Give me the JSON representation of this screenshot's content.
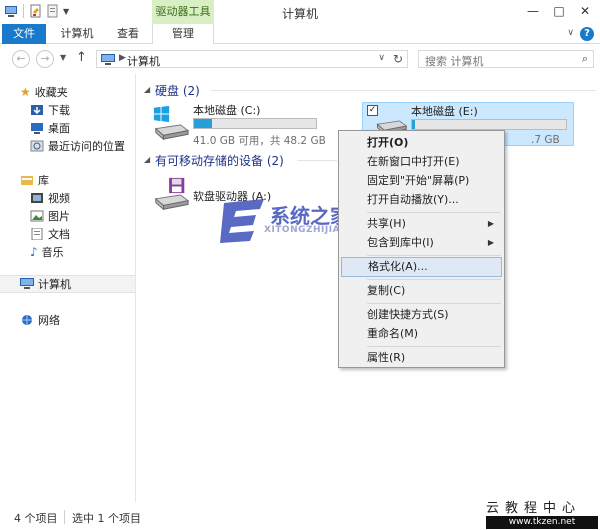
{
  "window": {
    "title": "计算机",
    "context_tab_group": "驱动器工具"
  },
  "ribbon": {
    "tabs": [
      "文件",
      "计算机",
      "查看",
      "管理"
    ],
    "help_glyph": "?"
  },
  "address": {
    "path": "计算机",
    "search_placeholder": "搜索 计算机"
  },
  "navpane": {
    "items": [
      "收藏夹",
      "下载",
      "桌面",
      "最近访问的位置",
      "库",
      "视频",
      "图片",
      "文档",
      "音乐",
      "计算机",
      "网络"
    ]
  },
  "content": {
    "groups": [
      {
        "title": "硬盘 (2)",
        "drives": [
          {
            "name": "本地磁盘 (C:)",
            "size": "41.0 GB 可用，共 48.2 GB",
            "fill": 0.15
          },
          {
            "name": "本地磁盘 (E:)",
            "size": ".7 GB",
            "fill": 0.02
          }
        ]
      },
      {
        "title": "有可移动存储的设备 (2)",
        "drives": [
          {
            "name": "软盘驱动器 (A:)"
          }
        ]
      }
    ]
  },
  "context_menu": {
    "items": [
      "打开(O)",
      "在新窗口中打开(E)",
      "固定到\"开始\"屏幕(P)",
      "打开自动播放(Y)...",
      "共享(H)",
      "包含到库中(I)",
      "格式化(A)...",
      "复制(C)",
      "创建快捷方式(S)",
      "重命名(M)",
      "属性(R)"
    ]
  },
  "status": {
    "item_count": "4 个项目",
    "selected_count": "选中 1 个项目"
  },
  "watermark": {
    "cn": "系统之家",
    "en": "XITONGZHIJIA.NET",
    "corner": "云教程中心",
    "url": "www.tkzen.net"
  },
  "colors": {
    "accent": "#1979ca",
    "context_tab": "#d7efc3",
    "selection": "#cce8ff",
    "capacity_bar": "#26a0da"
  }
}
